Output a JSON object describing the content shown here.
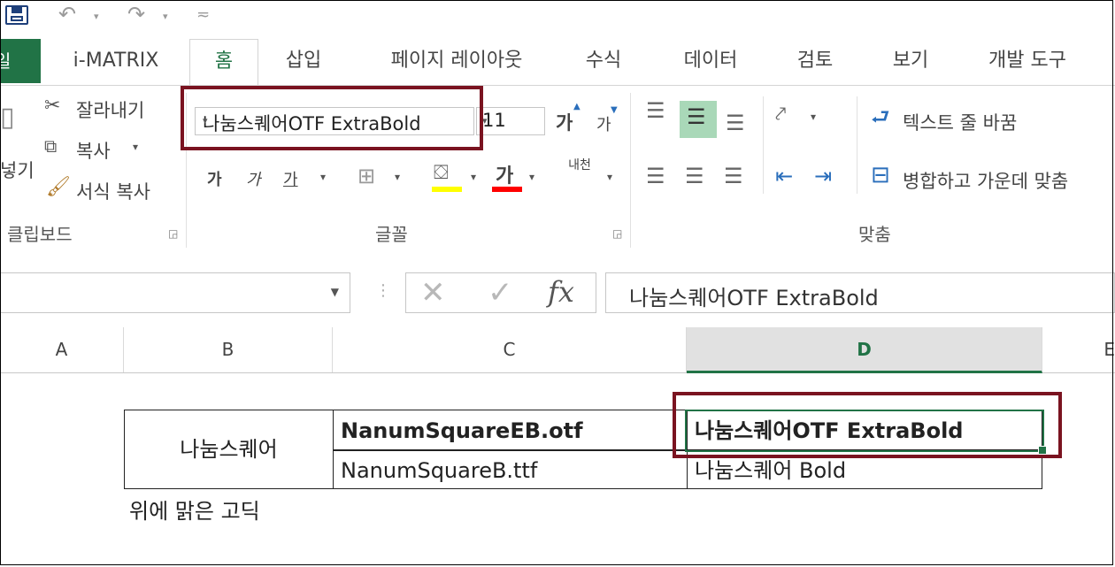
{
  "tabs": {
    "file": "일",
    "items": [
      "i-MATRIX",
      "홈",
      "삽입",
      "페이지 레이아웃",
      "수식",
      "데이터",
      "검토",
      "보기",
      "개발 도구"
    ],
    "active": "홈"
  },
  "clipboard": {
    "cut": "잘라내기",
    "copy": "복사",
    "format_painter": "서식 복사",
    "paste_partial": "넣기",
    "label": "클립보드"
  },
  "font": {
    "name": "나눔스퀘어OTF ExtraBold",
    "size": "11",
    "grow": "가",
    "shrink": "가",
    "bold": "가",
    "italic": "가",
    "underline": "가",
    "font_color": "가",
    "phonetic": "내천",
    "label": "글꼴"
  },
  "alignment": {
    "wrap_text": "텍스트 줄 바꿈",
    "merge_center": "병합하고 가운데 맞춤",
    "label": "맞춤"
  },
  "formula_bar": {
    "fx": "fx",
    "value": "나눔스퀘어OTF ExtraBold"
  },
  "columns": [
    "A",
    "B",
    "C",
    "D",
    "E"
  ],
  "selected_column": "D",
  "table": {
    "merged_label": "나눔스퀘어",
    "rows": [
      {
        "file": "NanumSquareEB.otf",
        "font": "나눔스퀘어OTF ExtraBold"
      },
      {
        "file": "NanumSquareB.ttf",
        "font": "나눔스퀘어 Bold"
      }
    ]
  },
  "note": "위에 맑은 고딕",
  "colors": {
    "accent": "#217346",
    "highlight": "#7a1320"
  }
}
